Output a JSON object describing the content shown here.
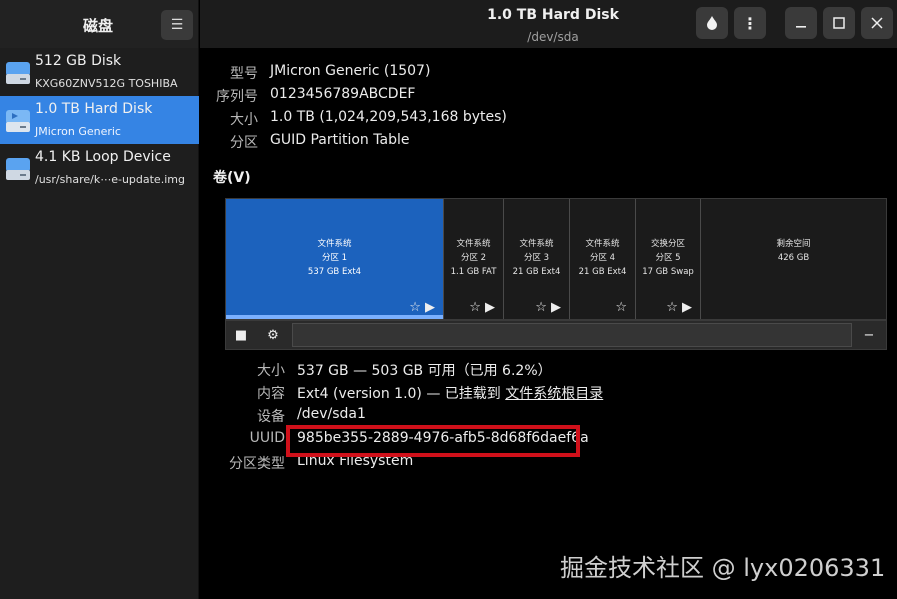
{
  "sidebar": {
    "title": "磁盘",
    "devices": [
      {
        "name": "512 GB Disk",
        "detail": "KXG60ZNV512G TOSHIBA",
        "selected": false
      },
      {
        "name": "1.0 TB Hard Disk",
        "detail": "JMicron Generic",
        "selected": true
      },
      {
        "name": "4.1 KB Loop Device",
        "detail": "/usr/share/k⋯e-update.img",
        "selected": false
      }
    ]
  },
  "header": {
    "title": "1.0 TB Hard Disk",
    "subtitle": "/dev/sda"
  },
  "disk_info": {
    "model_label": "型号",
    "model_value": "JMicron Generic (1507)",
    "serial_label": "序列号",
    "serial_value": "0123456789ABCDEF",
    "size_label": "大小",
    "size_value": "1.0 TB (1,024,209,543,168 bytes)",
    "partitioning_label": "分区",
    "partitioning_value": "GUID Partition Table"
  },
  "volumes": {
    "title": "卷(V)",
    "partitions": [
      {
        "line1": "文件系统",
        "line2": "分区 1",
        "line3": "537 GB Ext4",
        "selected": true
      },
      {
        "line1": "文件系统",
        "line2": "分区 2",
        "line3": "1.1 GB FAT",
        "selected": false
      },
      {
        "line1": "文件系统",
        "line2": "分区 3",
        "line3": "21 GB Ext4",
        "selected": false
      },
      {
        "line1": "文件系统",
        "line2": "分区 4",
        "line3": "21 GB Ext4",
        "selected": false
      },
      {
        "line1": "交换分区",
        "line2": "分区 5",
        "line3": "17 GB Swap",
        "selected": false
      },
      {
        "line1": "剩余空间",
        "line2": "426 GB",
        "line3": "",
        "selected": false
      }
    ],
    "usage_fraction": 0.062
  },
  "partition_info": {
    "size_label": "大小",
    "size_value": "537 GB — 503 GB 可用（已用 6.2%）",
    "contents_label": "内容",
    "contents_prefix": "Ext4 (version 1.0) — 已挂载到 ",
    "contents_link": "文件系统根目录",
    "device_label": "设备",
    "device_value": "/dev/sda1",
    "uuid_label": "UUID",
    "uuid_value": "985be355-2889-4976-afb5-8d68f6daef6a",
    "type_label": "分区类型",
    "type_value": "Linux Filesystem"
  },
  "watermark": "掘金技术社区 @ lyx0206331",
  "colors": {
    "accent": "#3584e4",
    "selected_partition": "#1c62bd",
    "highlight_box": "#d0101a"
  }
}
